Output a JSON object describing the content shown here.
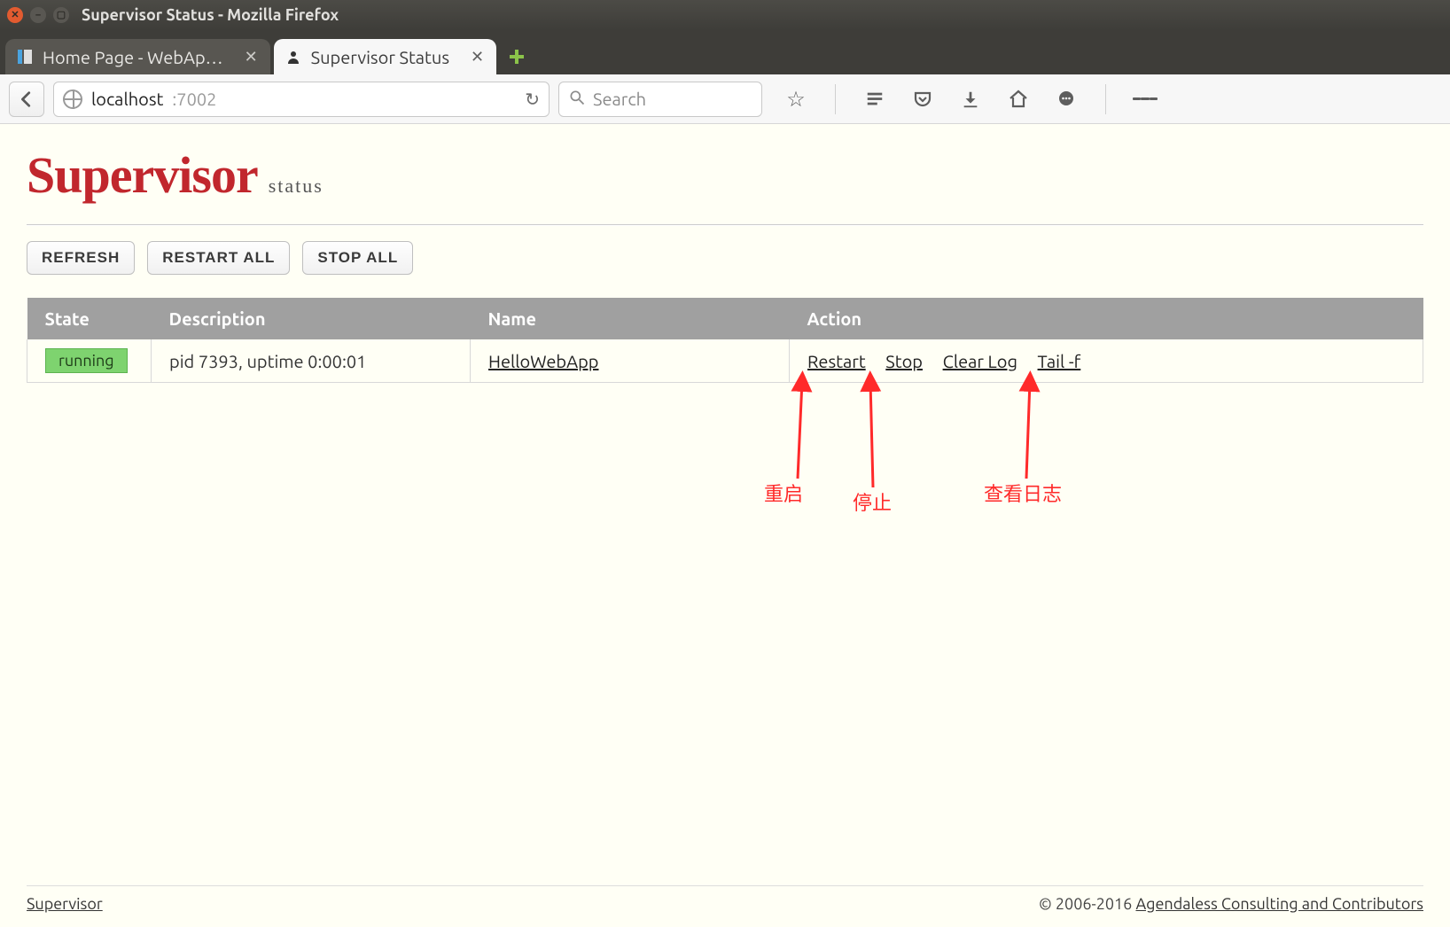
{
  "window": {
    "title": "Supervisor Status - Mozilla Firefox"
  },
  "tabs": {
    "inactive": {
      "label": "Home Page - WebAp…"
    },
    "active": {
      "label": "Supervisor Status"
    }
  },
  "url": {
    "host": "localhost",
    "port": ":7002"
  },
  "search": {
    "placeholder": "Search"
  },
  "brand": {
    "name": "Supervisor",
    "sub": "status"
  },
  "buttons": {
    "refresh": "REFRESH",
    "restart_all": "RESTART ALL",
    "stop_all": "STOP ALL"
  },
  "table": {
    "headers": {
      "state": "State",
      "desc": "Description",
      "name": "Name",
      "action": "Action"
    },
    "rows": [
      {
        "state": "running",
        "desc": "pid 7393, uptime 0:00:01",
        "name": "HelloWebApp",
        "actions": {
          "restart": "Restart",
          "stop": "Stop",
          "clearlog": "Clear Log",
          "tailf": "Tail -f"
        }
      }
    ]
  },
  "annotations": {
    "restart": "重启",
    "stop": "停止",
    "tailf": "查看日志"
  },
  "footer": {
    "left": "Supervisor",
    "right_prefix": "© 2006-2016 ",
    "right_link": "Agendaless Consulting and Contributors"
  }
}
